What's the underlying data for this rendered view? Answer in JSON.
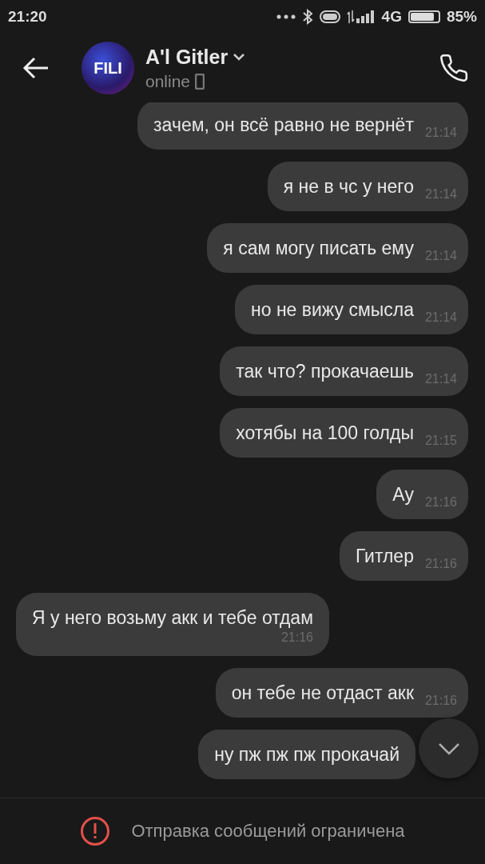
{
  "status_bar": {
    "time": "21:20",
    "network": "4G",
    "battery": "85%"
  },
  "header": {
    "avatar_text": "FILI",
    "name": "A'l Gitler",
    "status": "online"
  },
  "messages": [
    {
      "kind": "out",
      "text": "зачем, он всё равно не вернёт",
      "time": "21:14"
    },
    {
      "kind": "out",
      "text": "я не в чс у него",
      "time": "21:14"
    },
    {
      "kind": "out",
      "text": "я сам могу писать ему",
      "time": "21:14"
    },
    {
      "kind": "out",
      "text": "но не вижу смысла",
      "time": "21:14"
    },
    {
      "kind": "out",
      "text": "так что? прокачаешь",
      "time": "21:14"
    },
    {
      "kind": "out",
      "text": "хотябы на 100 голды",
      "time": "21:15"
    },
    {
      "kind": "out",
      "text": "Ау",
      "time": "21:16"
    },
    {
      "kind": "out",
      "text": "Гитлер",
      "time": "21:16"
    },
    {
      "kind": "in",
      "text": "Я у него возьму акк и тебе отдам",
      "time": "21:16"
    },
    {
      "kind": "out",
      "text": "он тебе не отдаст акк",
      "time": "21:16"
    },
    {
      "kind": "out",
      "text": "ну пж пж пж прокачай"
    }
  ],
  "notice": {
    "text": "Отправка сообщений ограничена"
  }
}
